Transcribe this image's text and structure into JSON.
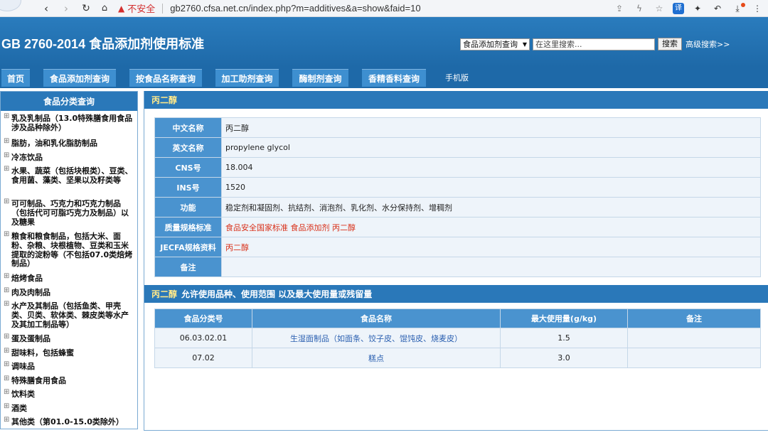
{
  "browser": {
    "insecure_label": "不安全",
    "url": "gb2760.cfsa.net.cn/index.php?m=additives&a=show&faid=10"
  },
  "header": {
    "title": "GB 2760-2014 食品添加剂使用标准",
    "search_type": "食品添加剂查询",
    "search_placeholder": "在这里搜索...",
    "search_button": "搜索",
    "advanced_link": "高级搜索>>"
  },
  "tabs": [
    "首页",
    "食品添加剂查询",
    "按食品名称查询",
    "加工助剂查询",
    "酶制剂查询",
    "香精香料查询"
  ],
  "mobile_link": "手机版",
  "sidebar": {
    "title": "食品分类查询",
    "categories": [
      "乳及乳制品（13.0特殊膳食用食品涉及品种除外）",
      "脂肪，油和乳化脂肪制品",
      "冷冻饮品",
      "水果、蔬菜（包括块根类）、豆类、食用菌、藻类、坚果以及籽类等",
      "可可制品、巧克力和巧克力制品（包括代可可脂巧克力及制品）以及糖果",
      "粮食和粮食制品，包括大米、面粉、杂粮、块根植物、豆类和玉米提取的淀粉等（不包括07.0类焙烤制品）",
      "焙烤食品",
      "肉及肉制品",
      "水产及其制品（包括鱼类、甲壳类、贝类、软体类、棘皮类等水产及其加工制品等）",
      "蛋及蛋制品",
      "甜味料，包括蜂蜜",
      "调味品",
      "特殊膳食用食品",
      "饮料类",
      "酒类",
      "其他类（第01.0-15.0类除外）"
    ]
  },
  "additive": {
    "name": "丙二醇",
    "fields": [
      {
        "key": "中文名称",
        "value": "丙二醇"
      },
      {
        "key": "英文名称",
        "value": "propylene glycol"
      },
      {
        "key": "CNS号",
        "value": "18.004"
      },
      {
        "key": "INS号",
        "value": "1520"
      },
      {
        "key": "功能",
        "value": "稳定剂和凝固剂、抗结剂、消泡剂、乳化剂、水分保持剂、增稠剂"
      },
      {
        "key": "质量规格标准",
        "value": "食品安全国家标准 食品添加剂 丙二醇",
        "link": true
      },
      {
        "key": "JECFA规格资料",
        "value": "丙二醇",
        "link": true
      },
      {
        "key": "备注",
        "value": ""
      }
    ]
  },
  "usage": {
    "heading_name": "丙二醇",
    "heading_text": "允许使用品种、使用范围 以及最大使用量或残留量",
    "columns": [
      "食品分类号",
      "食品名称",
      "最大使用量(g/kg)",
      "备注"
    ],
    "rows": [
      [
        "06.03.02.01",
        "生湿面制品（如面条、饺子皮、馄饨皮、烧麦皮）",
        "1.5",
        ""
      ],
      [
        "07.02",
        "糕点",
        "3.0",
        ""
      ]
    ]
  }
}
